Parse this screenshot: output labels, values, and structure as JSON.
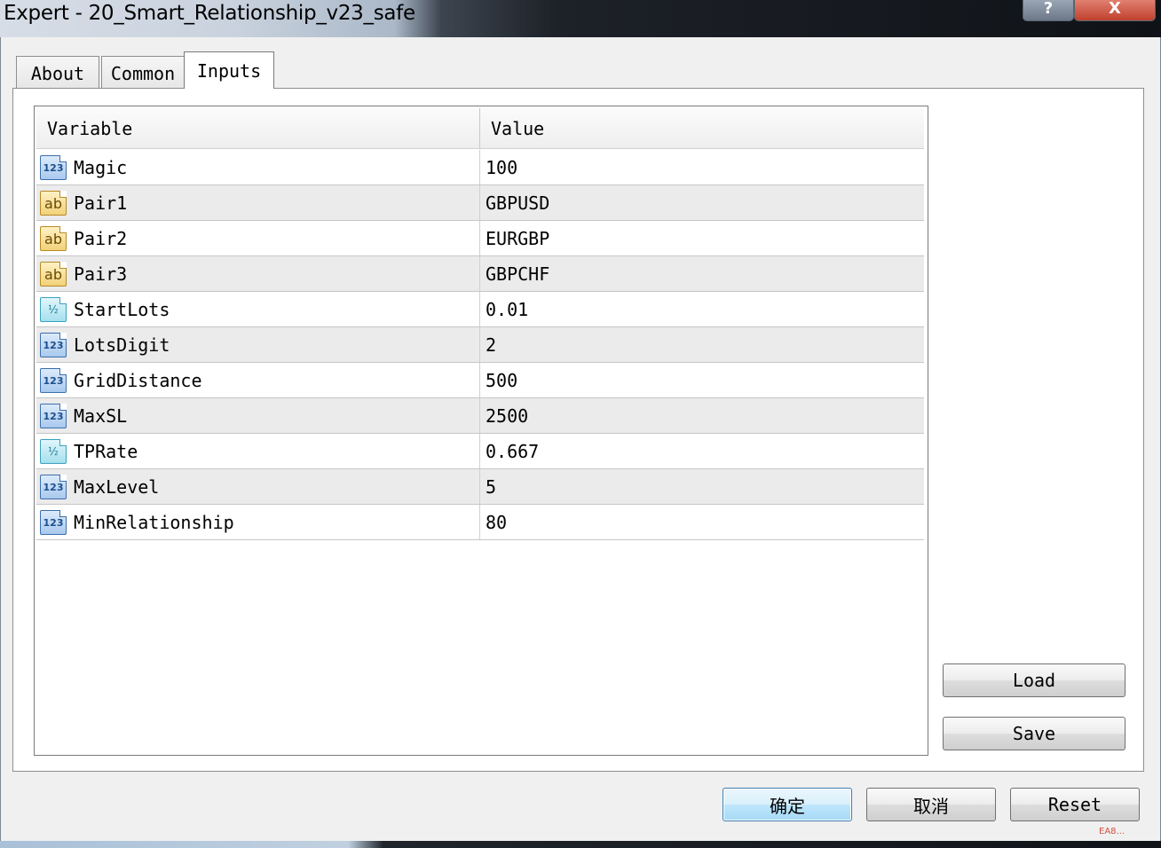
{
  "window": {
    "title": "Expert - 20_Smart_Relationship_v23_safe",
    "help_label": "?",
    "close_label": "X"
  },
  "tabs": [
    {
      "label": "About"
    },
    {
      "label": "Common"
    },
    {
      "label": "Inputs",
      "active": true
    }
  ],
  "grid": {
    "columns": {
      "variable": "Variable",
      "value": "Value"
    },
    "rows": [
      {
        "name": "Magic",
        "value": "100",
        "type": "int",
        "icon": "123"
      },
      {
        "name": "Pair1",
        "value": "GBPUSD",
        "type": "string",
        "icon": "ab"
      },
      {
        "name": "Pair2",
        "value": "EURGBP",
        "type": "string",
        "icon": "ab"
      },
      {
        "name": "Pair3",
        "value": "GBPCHF",
        "type": "string",
        "icon": "ab"
      },
      {
        "name": "StartLots",
        "value": "0.01",
        "type": "double",
        "icon": "½"
      },
      {
        "name": "LotsDigit",
        "value": "2",
        "type": "int",
        "icon": "123"
      },
      {
        "name": "GridDistance",
        "value": "500",
        "type": "int",
        "icon": "123"
      },
      {
        "name": "MaxSL",
        "value": "2500",
        "type": "int",
        "icon": "123"
      },
      {
        "name": "TPRate",
        "value": "0.667",
        "type": "double",
        "icon": "½"
      },
      {
        "name": "MaxLevel",
        "value": "5",
        "type": "int",
        "icon": "123"
      },
      {
        "name": "MinRelationship",
        "value": "80",
        "type": "int",
        "icon": "123"
      }
    ]
  },
  "buttons": {
    "load": "Load",
    "save": "Save",
    "ok": "确定",
    "cancel": "取消",
    "reset": "Reset"
  },
  "watermark": "EA8..."
}
